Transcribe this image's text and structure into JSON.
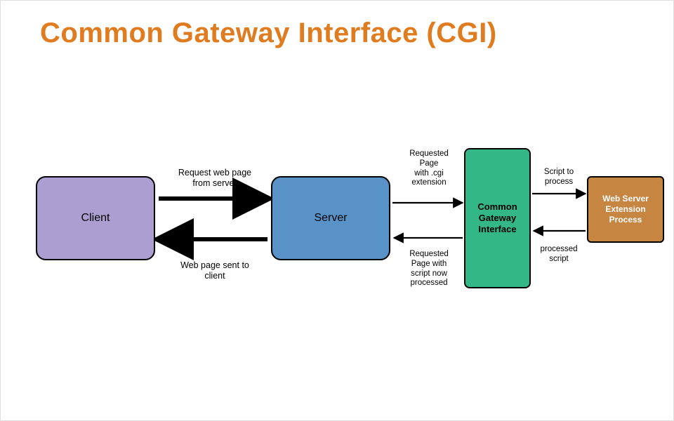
{
  "title": "Common Gateway Interface (CGI)",
  "nodes": {
    "client": "Client",
    "server": "Server",
    "cgi": "Common\nGateway\nInterface",
    "ext": "Web Server\nExtension\nProcess"
  },
  "edges": {
    "client_to_server": "Request web page\nfrom server",
    "server_to_client": "Web page sent to\nclient",
    "server_to_cgi": "Requested\nPage\nwith .cgi\nextension",
    "cgi_to_server": "Requested\nPage with\nscript now\nprocessed",
    "cgi_to_ext": "Script to\nprocess",
    "ext_to_cgi": "processed\nscript"
  },
  "colors": {
    "title": "#e07b1f",
    "client": "#ad9ed2",
    "server": "#5892c6",
    "cgi": "#34b786",
    "ext": "#c78542"
  }
}
